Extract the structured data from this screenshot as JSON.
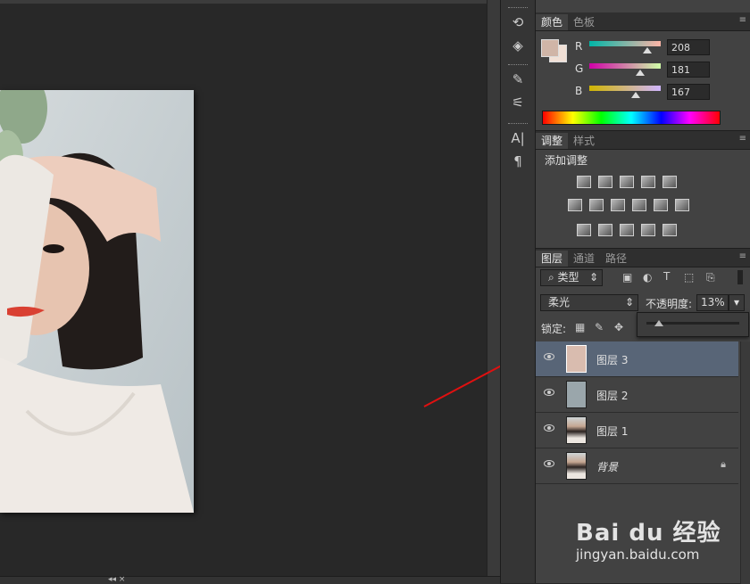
{
  "canvas": {
    "collapse_glyph": "◂◂",
    "bottom_glyphs": "◂◂ ×"
  },
  "dock": {
    "collapse_glyph": "◂◂",
    "icons": [
      "history-icon",
      "3d-icon",
      "brush-presets-icon",
      "brush-icon",
      "character-icon",
      "paragraph-icon"
    ],
    "glyphs": [
      "⟲",
      "◈",
      "✎",
      "⚟",
      "A|",
      "¶"
    ]
  },
  "color_panel": {
    "tabs": [
      "颜色",
      "色板"
    ],
    "menu_glyph": "≡",
    "foreground_color": "#d0b5a7",
    "background_color": "#f1e0d6",
    "channels": [
      {
        "label": "R",
        "value": "208",
        "fraction": 0.816
      },
      {
        "label": "G",
        "value": "181",
        "fraction": 0.71
      },
      {
        "label": "B",
        "value": "167",
        "fraction": 0.655
      }
    ]
  },
  "adjustments_panel": {
    "tabs": [
      "调整",
      "样式"
    ],
    "title": "添加调整",
    "icons": [
      "brightness-icon",
      "levels-icon",
      "curves-icon",
      "exposure-icon",
      "vibrance-icon",
      "hue-saturation-icon",
      "color-balance-icon",
      "black-white-icon",
      "photo-filter-icon",
      "channel-mixer-icon",
      "color-lookup-icon",
      "invert-icon",
      "posterize-icon",
      "threshold-icon",
      "selective-color-icon",
      "gradient-map-icon"
    ]
  },
  "layers_panel": {
    "tabs": [
      "图层",
      "通道",
      "路径"
    ],
    "filter_label": "类型",
    "blend_mode": "柔光",
    "opacity_label": "不透明度:",
    "opacity_value": "13%",
    "opacity_fraction": 0.13,
    "lock_label": "锁定:",
    "layers": [
      {
        "name": "图层 3",
        "thumb_color": "#d9bcaf",
        "selected": true,
        "locked": false
      },
      {
        "name": "图层 2",
        "thumb_color": "#9aa6ab",
        "selected": false,
        "locked": false
      },
      {
        "name": "图层 1",
        "thumb_color": "photo",
        "selected": false,
        "locked": false
      },
      {
        "name": "背景",
        "thumb_color": "photo",
        "selected": false,
        "locked": true
      }
    ]
  },
  "watermark": {
    "brand": "Bai du 经验",
    "url": "jingyan.baidu.com"
  },
  "colors": {
    "annotation_arrow": "#e01010"
  }
}
